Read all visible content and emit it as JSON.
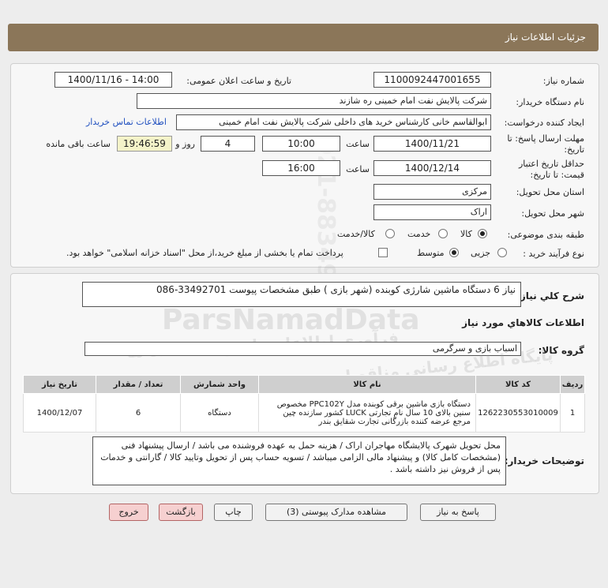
{
  "header": {
    "title": "جزئیات اطلاعات نیاز"
  },
  "form": {
    "need_number_label": "شماره نیاز:",
    "need_number": "1100092447001655",
    "announce_label": "تاریخ و ساعت اعلان عمومی:",
    "announce_value": "1400/11/16 - 14:00",
    "buyer_org_label": "نام دستگاه خریدار:",
    "buyer_org": "شرکت پالایش نفت امام خمینی  ره  شازند",
    "requester_label": "ایجاد کننده درخواست:",
    "requester": "ابوالقاسم  خانی  کارشناس خرید های داخلی  شرکت پالایش نفت امام خمینی",
    "contact_link": "اطلاعات تماس خریدار",
    "deadline_label_1": "مهلت ارسال پاسخ: تا",
    "deadline_label_2": "تاریخ:",
    "deadline_date": "1400/11/21",
    "time_label": "ساعت",
    "deadline_time": "10:00",
    "days_value": "4",
    "days_label": "روز و",
    "remaining_time": "19:46:59",
    "remaining_label": "ساعت باقی مانده",
    "validity_label_1": "حداقل تاریخ اعتبار",
    "validity_label_2": "قیمت: تا تاریخ:",
    "validity_date": "1400/12/14",
    "validity_time_label": "ساعت",
    "validity_time": "16:00",
    "province_label": "استان محل تحویل:",
    "province": "مرکزی",
    "city_label": "شهر محل تحویل:",
    "city": "اراک",
    "category_label": "طبقه بندی موضوعی:",
    "category_options": [
      "کالا",
      "خدمت",
      "کالا/خدمت"
    ],
    "process_label": "نوع فرآیند خرید :",
    "process_options": [
      "جزیی",
      "متوسط"
    ],
    "payment_note": "پرداخت تمام یا بخشی از مبلغ خرید،از محل \"اسناد خزانه اسلامی\" خواهد بود."
  },
  "summary": {
    "label": "شرح کلي نیاز:",
    "text": "نیاز 6 دستگاه ماشین شارژی کوبنده (شهر بازی ) طبق مشخصات پیوست 33492701-086"
  },
  "goods": {
    "section_title": "اطلاعات کالاهاي مورد نیاز",
    "group_label": "گروه کالا:",
    "group_value": "اسباب بازی و سرگرمی",
    "columns": [
      "ردیف",
      "کد کالا",
      "نام کالا",
      "واحد شمارش",
      "تعداد / مقدار",
      "تاریخ نیاز"
    ],
    "rows": [
      {
        "index": "1",
        "code": "1262230553010009",
        "name": "دستگاه بازی ماشین برقی کوبنده مدل PPC102Y مخصوص سنین بالای 10 سال نام تجارتی LUCK کشور سازنده چین مرجع عرضه کننده بازرگانی تجارت شقایق بندر",
        "unit": "دستگاه",
        "qty": "6",
        "date": "1400/12/07"
      }
    ]
  },
  "buyer_notes": {
    "label": "توضیحات خریدار:",
    "text": "محل تحویل شهرک پالایشگاه مهاجران اراک / هزینه حمل به عهده فروشنده می باشد / ارسال پیشنهاد فنی (مشخصات کامل کالا) و پیشنهاد مالی الزامی میباشد  / تسویه حساب پس از تحویل وتایید کالا / گارانتی و خدمات پس از فروش نیز داشته باشد ."
  },
  "buttons": {
    "reply": "پاسخ به نیاز",
    "attachments": "مشاهده مدارک پیوستی (3)",
    "print": "چاپ",
    "back": "بازگشت",
    "exit": "خروج"
  },
  "watermark": {
    "brand": "ParsNamadData",
    "line1": "پایگاه اطلاع رسانی مناقصات و مزایده ها",
    "line2": "فرآوری اطلاعات پارس نماد داده ها",
    "phone": "021-88349670"
  },
  "colors": {
    "header": "#8b7659",
    "link": "#1f4fbf",
    "time_box": "#f4f3c9",
    "exit_button": "#f6d0d0"
  }
}
